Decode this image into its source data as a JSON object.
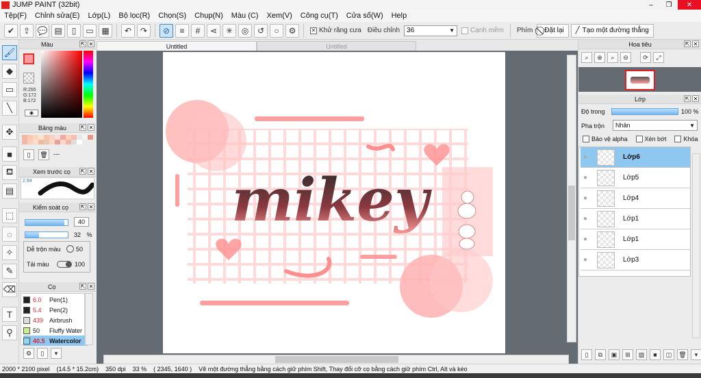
{
  "window": {
    "title": "JUMP PAINT (32bit)",
    "controls": [
      "–",
      "❐",
      "✕"
    ]
  },
  "menu": [
    "Tệp(F)",
    "Chỉnh sửa(E)",
    "Lớp(L)",
    "Bộ lọc(R)",
    "Chọn(S)",
    "Chụp(N)",
    "Màu (C)",
    "Xem(V)",
    "Công cụ(T)",
    "Cửa sổ(W)",
    "Help"
  ],
  "toolbar": {
    "antialias_label": "Khử răng cưa",
    "adjust_label": "Điều chỉnh",
    "adjust_value": "36",
    "edge_label": "Cạnh mềm",
    "key_label": "Phím",
    "reset_label": "Đặt lại",
    "line_label": "Tạo một đường thẳng"
  },
  "color_panel": {
    "title": "Màu",
    "primary_color": "#ff9a9a",
    "r": "R:255",
    "g": "G:172",
    "b": "B:172"
  },
  "palette_panel": {
    "title": "Bảng màu",
    "dash": "---"
  },
  "preview_panel": {
    "title": "Xem trước cọ",
    "size_value": "2.94"
  },
  "brush_control": {
    "title": "Kiểm soát cọ",
    "size_value": "40",
    "opacity_value": "32",
    "opacity_unit": "%",
    "mix_label": "Dễ trộn màu",
    "mix_value": "50",
    "load_label": "Tải màu",
    "load_value": "100"
  },
  "brushes": {
    "title": "Cọ",
    "items": [
      {
        "size": "6.0",
        "name": "Pen(1)",
        "color": "#222222"
      },
      {
        "size": "5.4",
        "name": "Pen(2)",
        "color": "#222222"
      },
      {
        "size": "439",
        "name": "Airbrush",
        "color": "#dddddd"
      },
      {
        "size": "50",
        "name": "Fluffy Water",
        "color": "#c8f08c"
      },
      {
        "size": "40.5",
        "name": "Watercolor",
        "color": "#8ed8f0"
      }
    ]
  },
  "canvas": {
    "tab_active": "Untitled",
    "tab_inactive": "Untitled",
    "artwork_text": "mikey",
    "accent": "#ff8f8f"
  },
  "navigator": {
    "title": "Hoa tiêu"
  },
  "layers_panel": {
    "title": "Lớp",
    "opacity_label": "Độ trong",
    "opacity_value": "100",
    "opacity_unit": "%",
    "blend_label": "Pha trộn",
    "blend_value": "Nhân",
    "protect_alpha": "Bảo vệ alpha",
    "clip_label": "Xén bớt",
    "lock_label": "Khóa",
    "layers": [
      "Lớp6",
      "Lớp5",
      "Lớp4",
      "Lớp1",
      "Lớp1",
      "Lớp3"
    ]
  },
  "status": {
    "size": "2000 * 2100 pixel",
    "cm": "(14.5 * 15.2cm)",
    "dpi": "350 dpi",
    "zoom": "33 %",
    "coords": "( 2345, 1640 )",
    "hint": "Vẽ một đường thẳng bằng cách giữ phím Shift, Thay đổi cỡ cọ bằng cách giữ phím Ctrl, Alt và kéo"
  }
}
